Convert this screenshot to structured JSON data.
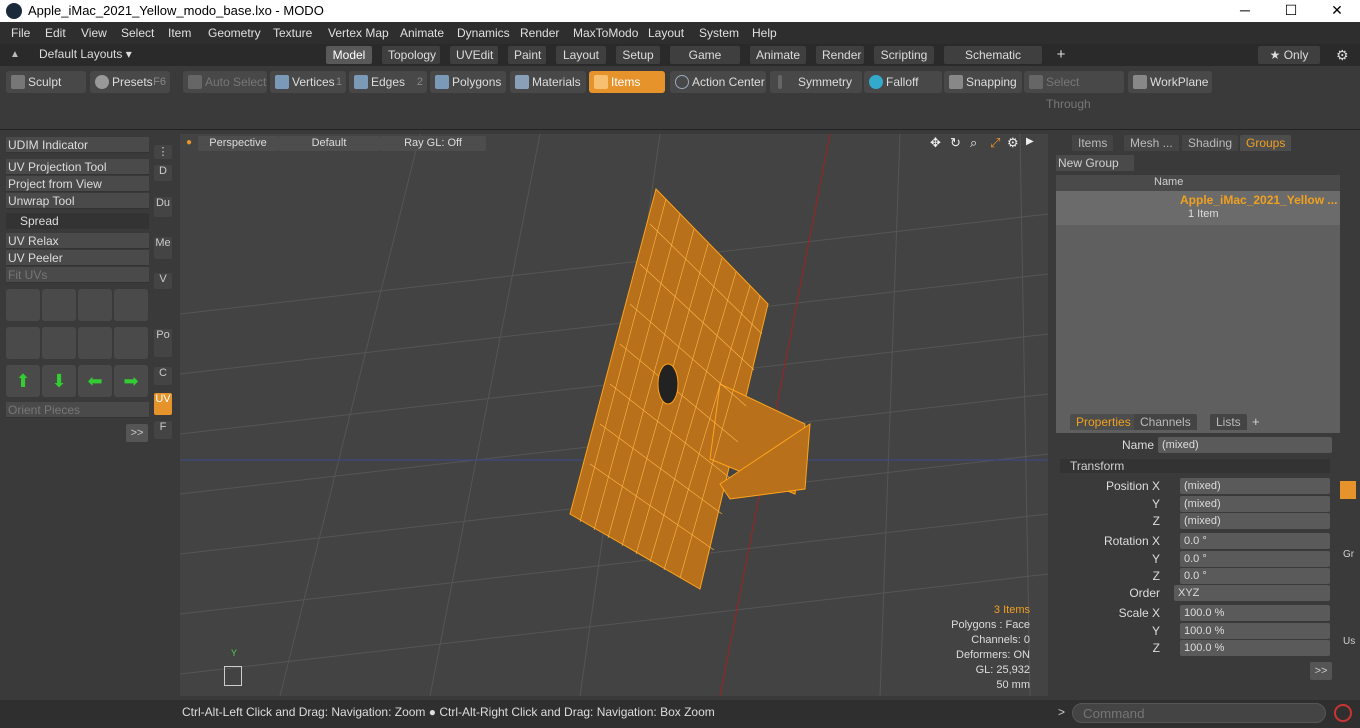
{
  "window": {
    "title": "Apple_iMac_2021_Yellow_modo_base.lxo - MODO",
    "minimize": "─",
    "maximize": "☐",
    "close": "✕"
  },
  "menu": [
    "File",
    "Edit",
    "View",
    "Select",
    "Item",
    "Geometry",
    "Texture",
    "Vertex Map",
    "Animate",
    "Dynamics",
    "Render",
    "MaxToModo",
    "Layout",
    "System",
    "Help"
  ],
  "layouts_label": "Default Layouts ▾",
  "tabs": [
    "Model",
    "Topology",
    "UVEdit",
    "Paint",
    "Layout",
    "Setup",
    "Game Tools",
    "Animate",
    "Render",
    "Scripting",
    "Schematic Fusion",
    "+"
  ],
  "only_label": "★ Only",
  "toolbar": {
    "sculpt": "Sculpt",
    "presets": "Presets",
    "presets_key": "F6",
    "auto_select": "Auto Select",
    "vertices": "Vertices",
    "vertices_n": "1",
    "edges": "Edges",
    "edges_n": "2",
    "polygons": "Polygons",
    "materials": "Materials",
    "items": "Items",
    "action_center": "Action Center",
    "symmetry": "Symmetry",
    "falloff": "Falloff",
    "snapping": "Snapping",
    "select_through": "Select Through",
    "workplane": "WorkPlane"
  },
  "left": {
    "udim": "UDIM Indicator",
    "uv_projection": "UV Projection Tool",
    "project_view": "Project from View",
    "unwrap": "Unwrap Tool",
    "spread": "Spread",
    "uv_relax": "UV Relax",
    "uv_peeler": "UV Peeler",
    "fit_uvs": "Fit UVs",
    "orient": "Orient Pieces",
    "more": ">>",
    "vtabs": [
      "D",
      "Du",
      "Me",
      "V",
      "Po",
      "C",
      "UV",
      "F"
    ]
  },
  "viewport": {
    "perspective": "Perspective",
    "default": "Default",
    "raygl": "Ray GL: Off",
    "items_count": "3 Items",
    "polygons": "Polygons : Face",
    "channels": "Channels: 0",
    "deformers": "Deformers: ON",
    "gl": "GL: 25,932",
    "scale": "50 mm",
    "axis_y": "Y"
  },
  "right": {
    "tabs": [
      "Items",
      "Mesh ...",
      "Shading",
      "Groups"
    ],
    "new_group": "New Group",
    "name_col": "Name",
    "group_name": "Apple_iMac_2021_Yellow ...",
    "group_sub": "1 Item",
    "ptabs": [
      "Properties",
      "Channels",
      "Lists",
      "+"
    ],
    "name_label": "Name",
    "name_val": "(mixed)",
    "transform": "Transform",
    "pos_x_label": "Position X",
    "pos_y_label": "Y",
    "pos_z_label": "Z",
    "pos_x": "(mixed)",
    "pos_y": "(mixed)",
    "pos_z": "(mixed)",
    "rot_x_label": "Rotation X",
    "rot_y_label": "Y",
    "rot_z_label": "Z",
    "rot_x": "0.0 °",
    "rot_y": "0.0 °",
    "rot_z": "0.0 °",
    "order_label": "Order",
    "order": "XYZ",
    "scl_x_label": "Scale X",
    "scl_y_label": "Y",
    "scl_z_label": "Z",
    "scl_x": "100.0 %",
    "scl_y": "100.0 %",
    "scl_z": "100.0 %",
    "more": ">>",
    "side": [
      "Gr",
      "Us"
    ]
  },
  "status": {
    "hint": "Ctrl-Alt-Left Click and Drag: Navigation: Zoom ● Ctrl-Alt-Right Click and Drag: Navigation: Box Zoom",
    "cmd_placeholder": "Command",
    "prompt": ">"
  },
  "colors": {
    "accent": "#e6932b",
    "wire": "#ffa31a"
  }
}
